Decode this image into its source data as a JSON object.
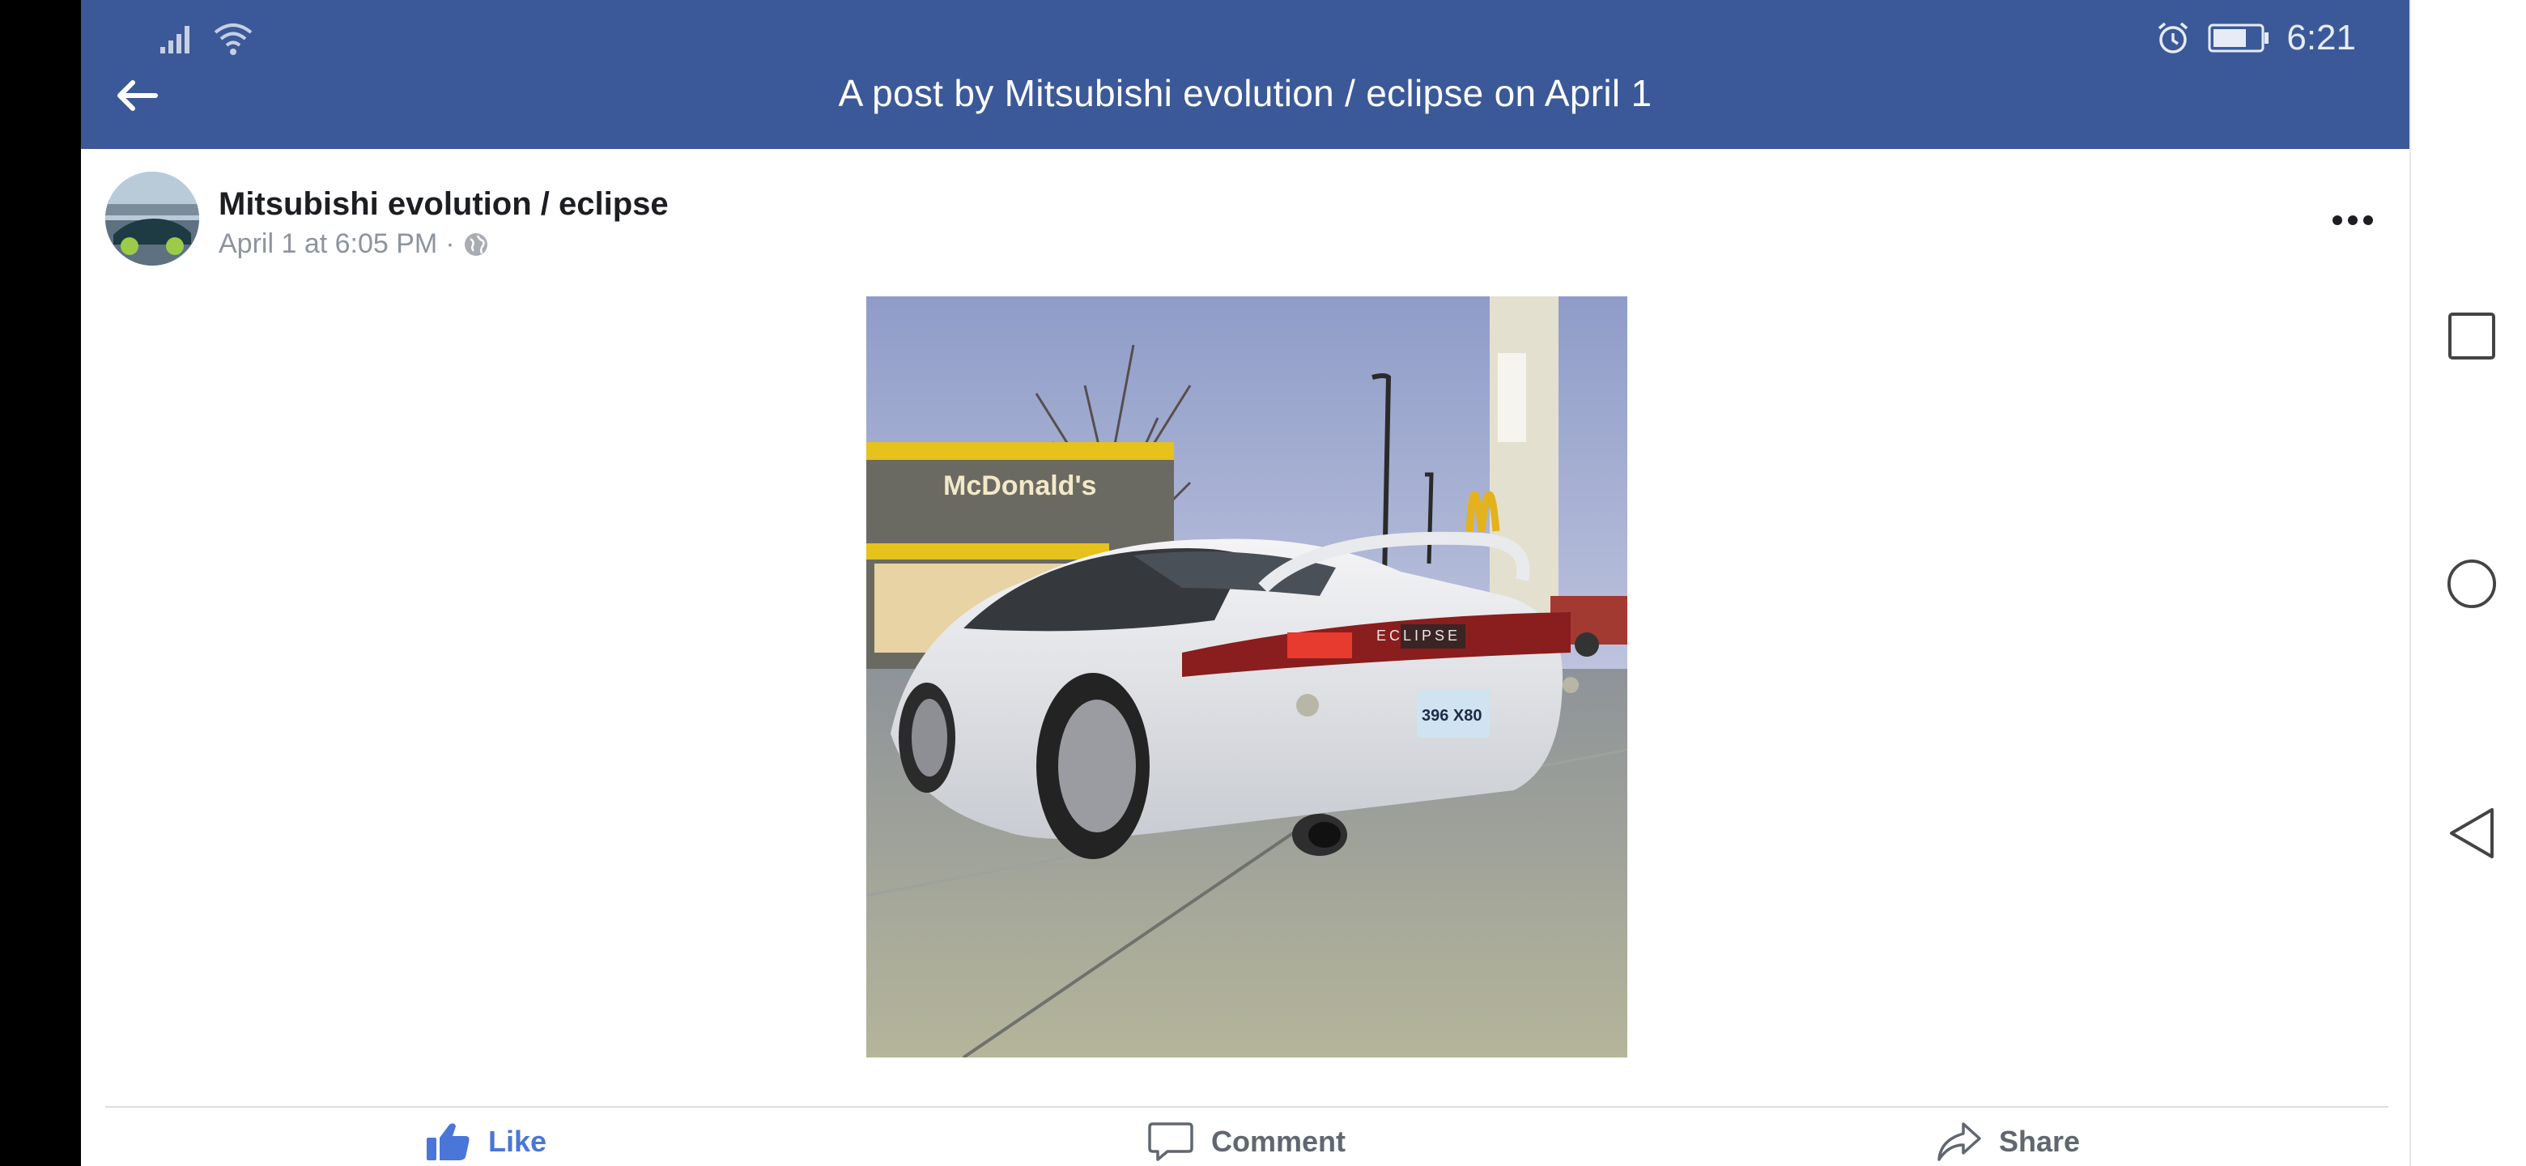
{
  "status_bar": {
    "time": "6:21",
    "icons": [
      "signal-icon",
      "wifi-icon",
      "alarm-icon",
      "battery-icon"
    ]
  },
  "header": {
    "title": "A post by Mitsubishi evolution / eclipse on April 1",
    "background": "#3b5998"
  },
  "post": {
    "author": "Mitsubishi evolution / eclipse",
    "timestamp": "April 1 at 6:05 PM",
    "separator": "·",
    "privacy_icon": "globe-icon",
    "photo_text": {
      "storefront": "McDonald's",
      "badge": "ECLIPSE",
      "plate": "396 X80"
    }
  },
  "actions": {
    "like": "Like",
    "comment": "Comment",
    "share": "Share",
    "like_color": "#4a76d9"
  },
  "system_nav": [
    "recents-icon",
    "home-icon",
    "back-triangle-icon"
  ]
}
